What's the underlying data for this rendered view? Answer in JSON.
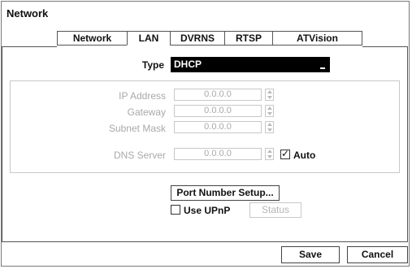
{
  "window": {
    "title": "Network"
  },
  "tabs": [
    {
      "label": "Network",
      "active": false
    },
    {
      "label": "LAN",
      "active": true
    },
    {
      "label": "DVRNS",
      "active": false
    },
    {
      "label": "RTSP",
      "active": false
    },
    {
      "label": "ATVision",
      "active": false
    }
  ],
  "type": {
    "label": "Type",
    "value": "DHCP"
  },
  "ip_fields": [
    {
      "label": "IP Address",
      "value": "0.0.0.0"
    },
    {
      "label": "Gateway",
      "value": "0.0.0.0"
    },
    {
      "label": "Subnet Mask",
      "value": "0.0.0.0"
    }
  ],
  "dns": {
    "label": "DNS Server",
    "value": "0.0.0.0",
    "auto_label": "Auto",
    "auto_checked": true
  },
  "port_button": {
    "label": "Port Number Setup..."
  },
  "upnp": {
    "label": "Use UPnP",
    "checked": false,
    "status_label": "Status"
  },
  "footer": {
    "save_label": "Save",
    "cancel_label": "Cancel"
  },
  "colors": {
    "select_bg": "#000000",
    "disabled_text": "#a9a9a9",
    "border": "#555555"
  }
}
